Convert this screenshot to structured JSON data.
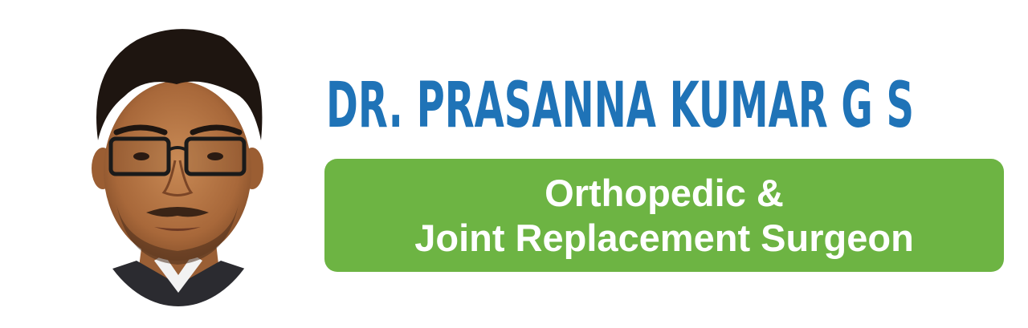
{
  "doctor": {
    "name": "DR. PRASANNA KUMAR G S",
    "title_line_1": "Orthopedic &",
    "title_line_2": "Joint Replacement Surgeon"
  },
  "colors": {
    "name_blue": "#1f73b7",
    "box_green": "#6db443",
    "background": "#ffffff"
  }
}
